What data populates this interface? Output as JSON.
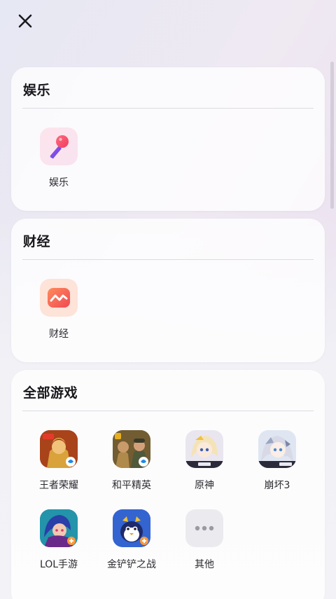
{
  "header": {
    "close_icon": "close-icon"
  },
  "sections": {
    "entertainment": {
      "title": "娱乐",
      "items": [
        {
          "label": "娱乐",
          "icon": "microphone-icon"
        }
      ]
    },
    "finance": {
      "title": "财经",
      "items": [
        {
          "label": "财经",
          "icon": "chart-wave-icon"
        }
      ]
    },
    "games": {
      "title": "全部游戏",
      "items": [
        {
          "label": "王者荣耀",
          "icon": "honor-of-kings-icon"
        },
        {
          "label": "和平精英",
          "icon": "peacekeeper-elite-icon"
        },
        {
          "label": "原神",
          "icon": "genshin-impact-icon"
        },
        {
          "label": "崩坏3",
          "icon": "honkai-impact-3-icon"
        },
        {
          "label": "LOL手游",
          "icon": "lol-mobile-icon"
        },
        {
          "label": "金铲铲之战",
          "icon": "golden-spatula-icon"
        },
        {
          "label": "其他",
          "icon": "more-dots-icon"
        }
      ]
    }
  },
  "colors": {
    "accent_pink": "#f2506e",
    "accent_purple": "#7a4de8",
    "finance_orange": "#f36b4e"
  }
}
